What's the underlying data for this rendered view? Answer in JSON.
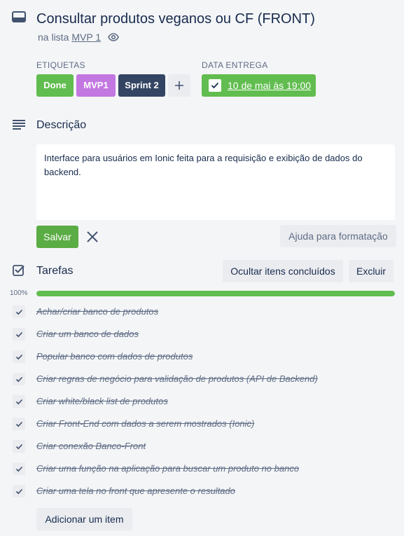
{
  "card": {
    "title": "Consultar produtos veganos ou CF (FRONT)",
    "list_prefix": "na lista",
    "list_name": "MVP 1"
  },
  "labels": {
    "heading": "ETIQUETAS",
    "items": [
      {
        "text": "Done",
        "color": "#61bd4f"
      },
      {
        "text": "MVP1",
        "color": "#c377e0"
      },
      {
        "text": "Sprint 2",
        "color": "#344563"
      }
    ]
  },
  "due": {
    "heading": "DATA ENTREGA",
    "date": "10 de mai às 19:00",
    "complete": true
  },
  "description": {
    "heading": "Descrição",
    "text": "Interface para usuários em Ionic feita para a requisição e exibição de dados do backend.",
    "save_label": "Salvar",
    "format_help_label": "Ajuda para formatação"
  },
  "checklist": {
    "heading": "Tarefas",
    "hide_completed_label": "Ocultar itens concluídos",
    "delete_label": "Excluir",
    "progress_text": "100%",
    "progress": 1.0,
    "items": [
      "Achar/criar banco de produtos",
      "Criar um banco de dados",
      "Popular banco com dados de produtos",
      "Criar regras de negócio para validação de produtos (API de Backend)",
      "Criar white/black list de produtos",
      "Criar Front-End com dados a serem mostrados (Ionic)",
      "Criar conexão Banco-Front",
      "Criar uma função na aplicação para buscar um produto no banco",
      "Criar uma tela no front que apresente o resultado"
    ],
    "add_item_label": "Adicionar um item"
  },
  "colors": {
    "accent_green": "#61bd4f",
    "save_green": "#5aac44",
    "text_dark": "#172b4d",
    "text_muted": "#5e6c84"
  }
}
